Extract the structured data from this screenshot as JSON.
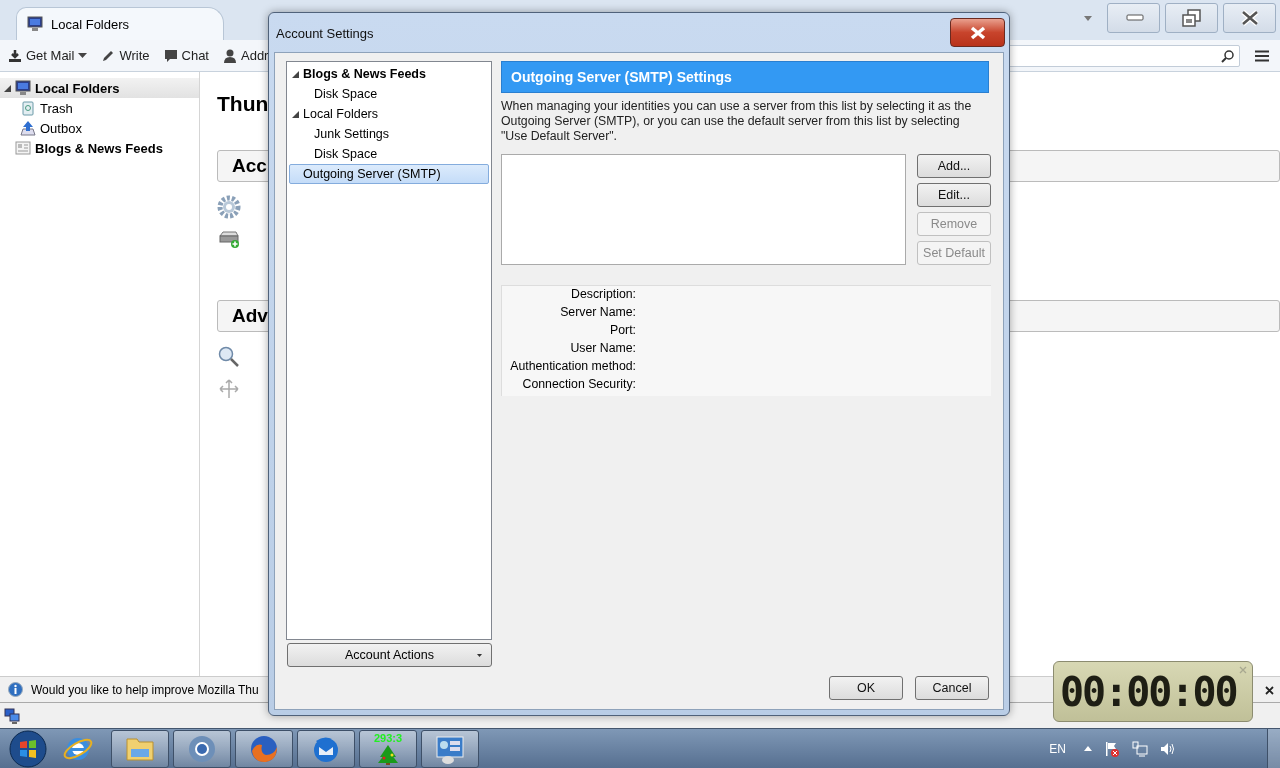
{
  "app": {
    "tab": {
      "label": "Local Folders"
    },
    "toolbar": [
      {
        "label": "Get Mail",
        "kind": "split"
      },
      {
        "label": "Write",
        "kind": "pencil"
      },
      {
        "label": "Chat",
        "kind": "bubble"
      },
      {
        "label": "Addr",
        "kind": "person"
      }
    ],
    "folders": [
      {
        "label": "Local Folders",
        "bold": true,
        "selected": true,
        "expanded": true,
        "kind": "computer",
        "children": [
          {
            "label": "Trash",
            "bold": false,
            "selected": false,
            "kind": "trash"
          },
          {
            "label": "Outbox",
            "bold": false,
            "selected": false,
            "kind": "outbox"
          }
        ]
      },
      {
        "label": "Blogs & News Feeds",
        "bold": true,
        "selected": false,
        "kind": "feeds"
      }
    ],
    "content": {
      "title": "Thun",
      "sections": [
        {
          "heading": "Acc",
          "items": [
            {
              "kind": "gear"
            },
            {
              "kind": "drive"
            }
          ]
        },
        {
          "heading": "Adv",
          "items": [
            {
              "kind": "search"
            },
            {
              "kind": "move"
            }
          ]
        }
      ]
    },
    "notification": {
      "text": "Would you like to help improve Mozilla Thu"
    }
  },
  "dialog": {
    "title": "Account Settings",
    "tree": [
      {
        "label": "Blogs & News Feeds",
        "bold": true,
        "expanded": true,
        "selected": false,
        "children": [
          {
            "label": "Disk Space",
            "selected": false
          }
        ]
      },
      {
        "label": "Local Folders",
        "bold": false,
        "expanded": true,
        "selected": false,
        "children": [
          {
            "label": "Junk Settings",
            "selected": false
          },
          {
            "label": "Disk Space",
            "selected": false
          }
        ]
      },
      {
        "label": "Outgoing Server (SMTP)",
        "bold": false,
        "selected": true
      }
    ],
    "account_actions": "Account Actions",
    "panel_title": "Outgoing Server (SMTP) Settings",
    "description": "When managing your identities you can use a server from this list by selecting it as the Outgoing Server (SMTP), or you can use the default server from this list by selecting \"Use Default Server\".",
    "buttons": [
      {
        "label": "Add...",
        "disabled": false
      },
      {
        "label": "Edit...",
        "disabled": false
      },
      {
        "label": "Remove",
        "disabled": true
      },
      {
        "label": "Set Default",
        "disabled": true
      }
    ],
    "details": [
      "Description:",
      "Server Name:",
      "Port:",
      "User Name:",
      "Authentication method:",
      "Connection Security:"
    ],
    "footer": [
      "OK",
      "Cancel"
    ]
  },
  "timer": {
    "display": "00:00:00"
  },
  "taskbar": {
    "apps": [
      {
        "kind": "globe",
        "pinned": false
      },
      {
        "kind": "folder",
        "pinned": true
      },
      {
        "kind": "chrome",
        "pinned": true
      },
      {
        "kind": "fox",
        "pinned": true
      },
      {
        "kind": "bird",
        "pinned": true
      },
      {
        "kind": "tree",
        "pinned": true,
        "badge": "293:3"
      },
      {
        "kind": "panel",
        "pinned": true
      }
    ],
    "language": "EN"
  }
}
